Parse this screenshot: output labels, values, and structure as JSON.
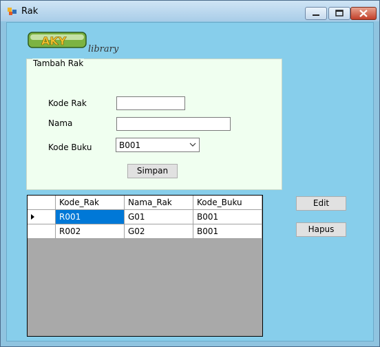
{
  "window": {
    "title": "Rak",
    "icon": "app-icon"
  },
  "logo": {
    "word": "AKY",
    "tagline": "library",
    "accent": "#2e7d32",
    "brand_green": "#7cb342",
    "brand_yellow": "#f4c430"
  },
  "group": {
    "legend": "Tambah Rak"
  },
  "form": {
    "kode_rak_label": "Kode Rak",
    "kode_rak_value": "",
    "nama_label": "Nama",
    "nama_value": "",
    "kode_buku_label": "Kode Buku",
    "kode_buku_value": "B001",
    "simpan_label": "Simpan"
  },
  "actions": {
    "edit_label": "Edit",
    "hapus_label": "Hapus"
  },
  "table": {
    "columns": [
      "Kode_Rak",
      "Nama_Rak",
      "Kode_Buku"
    ],
    "rows": [
      [
        "R001",
        "G01",
        "B001"
      ],
      [
        "R002",
        "G02",
        "B001"
      ]
    ],
    "selected_color": "#0078d7"
  }
}
